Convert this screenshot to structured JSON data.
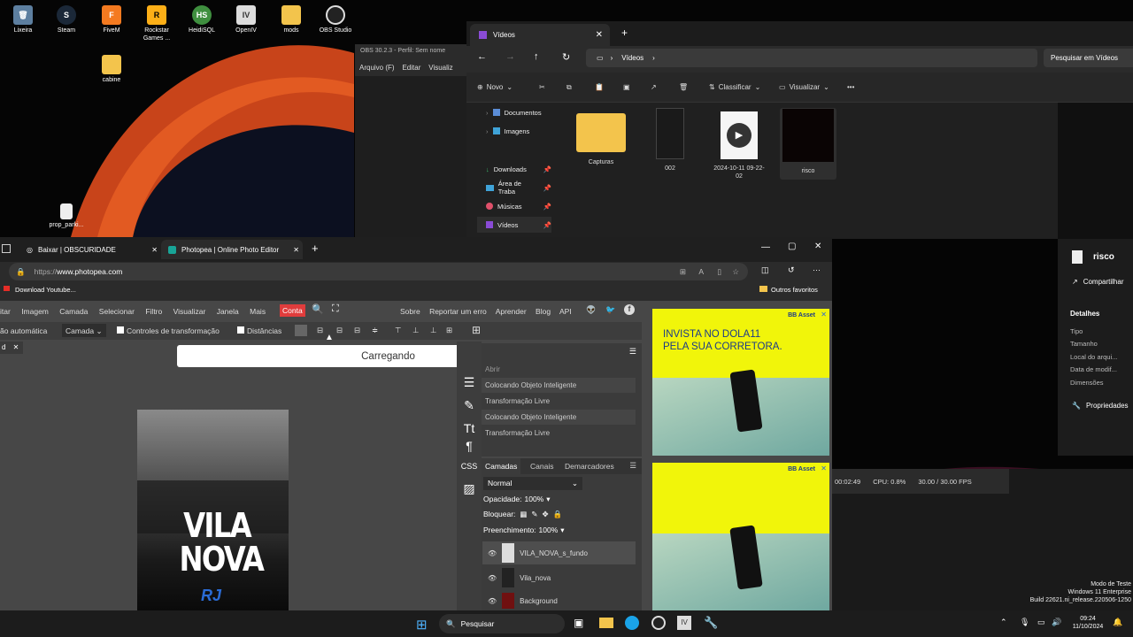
{
  "desktop": {
    "icons": [
      {
        "label": "Lixeira"
      },
      {
        "label": "Steam"
      },
      {
        "label": "FiveM"
      },
      {
        "label": "Rockstar Games ..."
      },
      {
        "label": "HeidiSQL"
      },
      {
        "label": "OpenIV"
      },
      {
        "label": "mods"
      },
      {
        "label": "OBS Studio"
      },
      {
        "label": "cabine"
      },
      {
        "label": "prop_parki..."
      }
    ],
    "watermark": {
      "line1": "Modo de Teste",
      "line2": "Windows 11 Enterprise",
      "line3": "Build 22621.ni_release.220506-1250"
    }
  },
  "obs": {
    "title": "OBS 30.2.3 - Perfil: Sem nome",
    "menu": [
      "Arquivo (F)",
      "Editar",
      "Visualiz"
    ],
    "status": {
      "time": "00:02:49",
      "cpu": "CPU: 0.8%",
      "fps": "30.00 / 30.00 FPS"
    }
  },
  "explorer": {
    "tab_title": "Vídeos",
    "breadcrumb": "Vídeos",
    "search_placeholder": "Pesquisar em Vídeos",
    "commands": {
      "new": "Novo",
      "sort": "Classificar",
      "view": "Visualizar"
    },
    "nav": [
      {
        "label": "Documentos"
      },
      {
        "label": "Imagens"
      },
      {
        "label": "Downloads"
      },
      {
        "label": "Área de Traba"
      },
      {
        "label": "Músicas"
      },
      {
        "label": "Vídeos"
      }
    ],
    "files": [
      {
        "name": "Capturas"
      },
      {
        "name": "002"
      },
      {
        "name": "2024-10-11 09-22-02"
      },
      {
        "name": "risco"
      }
    ],
    "details": {
      "name": "risco",
      "share": "Compartilhar",
      "section": "Detalhes",
      "fields": [
        "Tipo",
        "Tamanho",
        "Local do arqui...",
        "Data de modif...",
        "Dimensões"
      ],
      "properties": "Propriedades"
    }
  },
  "browser": {
    "tabs": [
      {
        "title": "Baixar | OBSCURIDADE"
      },
      {
        "title": "Photopea | Online Photo Editor"
      }
    ],
    "url_prefix": "https://",
    "url_host": "www.photopea.com",
    "bookmark": "Download Youtube...",
    "favorites": "Outros favoritos"
  },
  "photopea": {
    "menu": [
      "itar",
      "Imagem",
      "Camada",
      "Selecionar",
      "Filtro",
      "Visualizar",
      "Janela",
      "Mais"
    ],
    "account": "Conta",
    "right_menu": [
      "Sobre",
      "Reportar um erro",
      "Aprender",
      "Blog",
      "API"
    ],
    "options": {
      "auto": "ão automática",
      "layer_select": "Camada",
      "transform": "Controles de transformação",
      "distances": "Distâncias"
    },
    "loading": "Carregando",
    "history": [
      "Abrir",
      "Colocando Objeto Inteligente",
      "Transformação Livre",
      "Colocando Objeto Inteligente",
      "Transformação Livre"
    ],
    "layers_tabs": [
      "Camadas",
      "Canais",
      "Demarcadores"
    ],
    "blend": "Normal",
    "opacity_label": "Opacidade:",
    "opacity": "100%",
    "lock_label": "Bloquear:",
    "fill_label": "Preenchimento:",
    "fill": "100%",
    "layers": [
      {
        "name": "VILA_NOVA_s_fundo"
      },
      {
        "name": "Vila_nova"
      },
      {
        "name": "Background"
      }
    ],
    "canvas_text": {
      "line1": "VILA",
      "line2": "NOVA",
      "line3": "RJ"
    }
  },
  "ads": [
    {
      "brand": "BB Asset",
      "line1": "INVISTA NO DOLA11",
      "line2": "PELA SUA CORRETORA."
    },
    {
      "brand": "BB Asset"
    }
  ],
  "taskbar": {
    "search": "Pesquisar",
    "time": "09:24",
    "date": "11/10/2024"
  }
}
